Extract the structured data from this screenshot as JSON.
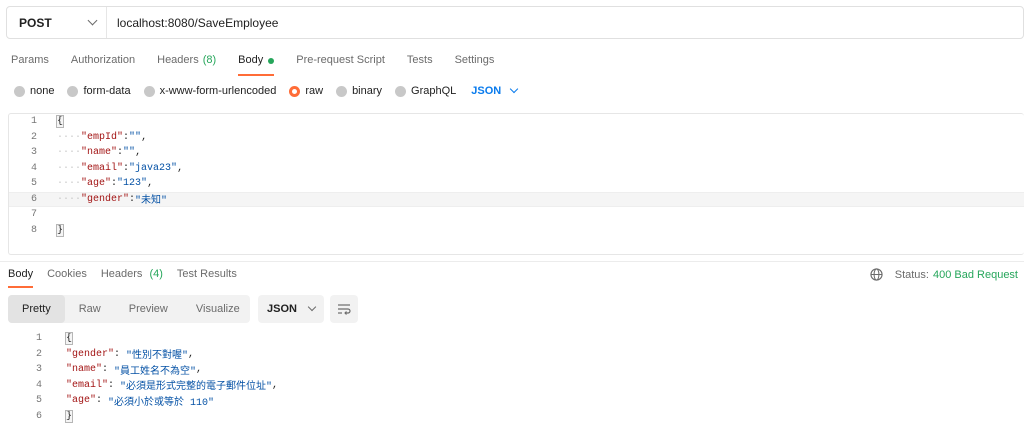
{
  "request": {
    "method": "POST",
    "url": "localhost:8080/SaveEmployee"
  },
  "request_tabs": [
    {
      "label": "Params"
    },
    {
      "label": "Authorization"
    },
    {
      "label": "Headers",
      "count": "(8)"
    },
    {
      "label": "Body",
      "active": true
    },
    {
      "label": "Pre-request Script"
    },
    {
      "label": "Tests"
    },
    {
      "label": "Settings"
    }
  ],
  "body_types": {
    "none": "none",
    "form_data": "form-data",
    "urlencoded": "x-www-form-urlencoded",
    "raw": "raw",
    "binary": "binary",
    "graphql": "GraphQL",
    "selected": "raw",
    "language": "JSON"
  },
  "request_body": {
    "line_numbers": [
      "1",
      "2",
      "3",
      "4",
      "5",
      "6",
      "7",
      "8"
    ],
    "open": "{",
    "close": "}",
    "fields": [
      {
        "key": "\"empId\"",
        "value": "\"\""
      },
      {
        "key": "\"name\"",
        "value": "\"\""
      },
      {
        "key": "\"email\"",
        "value": "\"java23\""
      },
      {
        "key": "\"age\"",
        "value": "\"123\""
      },
      {
        "key": "\"gender\"",
        "value": "\"未知\""
      }
    ]
  },
  "response_tabs": {
    "body": "Body",
    "cookies": "Cookies",
    "headers": "Headers",
    "headers_count": "(4)",
    "test_results": "Test Results"
  },
  "response_status": {
    "label": "Status:",
    "value": "400 Bad Request"
  },
  "response_toolbar": {
    "pretty": "Pretty",
    "raw": "Raw",
    "preview": "Preview",
    "visualize": "Visualize",
    "format": "JSON"
  },
  "response_body": {
    "line_numbers": [
      "1",
      "2",
      "3",
      "4",
      "5",
      "6"
    ],
    "open": "{",
    "close": "}",
    "fields": [
      {
        "key": "\"gender\"",
        "value": "\"性別不對喔\""
      },
      {
        "key": "\"name\"",
        "value": "\"員工姓名不為空\""
      },
      {
        "key": "\"email\"",
        "value": "\"必須是形式完整的電子郵件位址\""
      },
      {
        "key": "\"age\"",
        "value": "\"必須小於或等於 110\""
      }
    ]
  },
  "colors": {
    "accent": "#ff6c37",
    "success": "#26a65b",
    "link": "#097bed"
  },
  "icons": [
    "chevron-down-icon",
    "radio-icon",
    "globe-icon",
    "wrap-lines-icon"
  ]
}
